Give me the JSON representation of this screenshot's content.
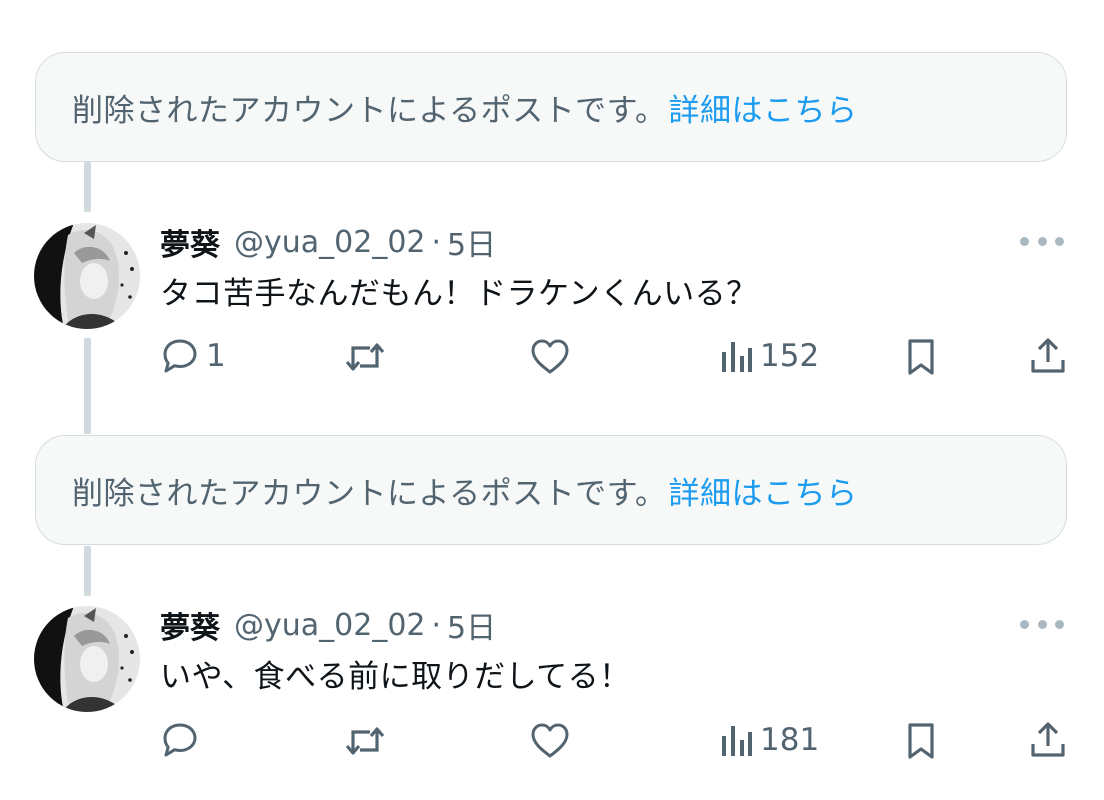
{
  "deleted_notice": {
    "text": "削除されたアカウントによるポストです。",
    "link": "詳細はこちら"
  },
  "posts": [
    {
      "author_name": "夢葵",
      "handle": "@yua_02_02",
      "separator": "·",
      "time": "5日",
      "text": "タコ苦手なんだもん！ドラケンくんいる？",
      "reply_count": "1",
      "repost_count": "",
      "like_count": "",
      "views": "152"
    },
    {
      "author_name": "夢葵",
      "handle": "@yua_02_02",
      "separator": "·",
      "time": "5日",
      "text": "いや、食べる前に取りだしてる！",
      "reply_count": "",
      "repost_count": "",
      "like_count": "",
      "views": "181"
    }
  ],
  "icons": {
    "reply": "speech-bubble-icon",
    "repost": "repost-arrows-icon",
    "like": "heart-icon",
    "views": "bar-chart-icon",
    "bookmark": "bookmark-icon",
    "share": "share-upload-icon",
    "more": "ellipsis-icon"
  },
  "colors": {
    "link": "#1d9bf0",
    "secondary_text": "#536471",
    "primary_text": "#0f1419",
    "thread_line": "#cfd9de",
    "notice_bg": "#f7f9f9"
  }
}
